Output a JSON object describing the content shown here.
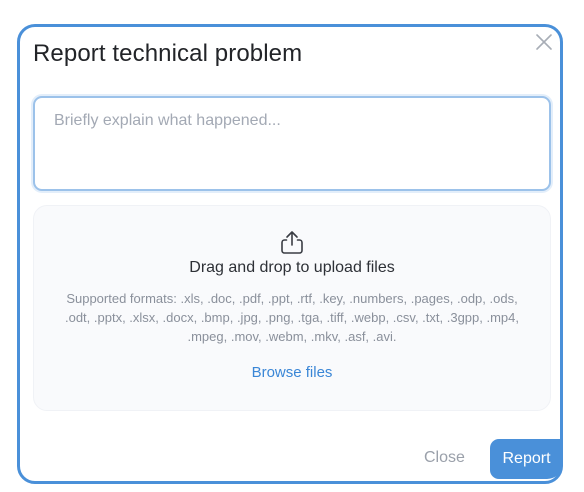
{
  "dialog": {
    "title": "Report technical problem",
    "close_icon": "close-x-icon",
    "description": {
      "value": "",
      "placeholder": "Briefly explain what happened..."
    },
    "dropzone": {
      "icon": "upload-icon",
      "title": "Drag and drop to upload files",
      "formats_text": "Supported formats: .xls, .doc, .pdf, .ppt, .rtf, .key, .numbers, .pages, .odp, .ods, .odt, .pptx, .xlsx, .docx, .bmp, .jpg, .png, .tga, .tiff, .webp, .csv, .txt, .3gpp, .mp4, .mpeg, .mov, .webm, .mkv, .asf, .avi.",
      "browse_label": "Browse files"
    },
    "buttons": {
      "close_label": "Close",
      "report_label": "Report"
    }
  },
  "colors": {
    "accent": "#4a90d9",
    "link": "#3a86d6",
    "muted_text": "#8a909b"
  }
}
